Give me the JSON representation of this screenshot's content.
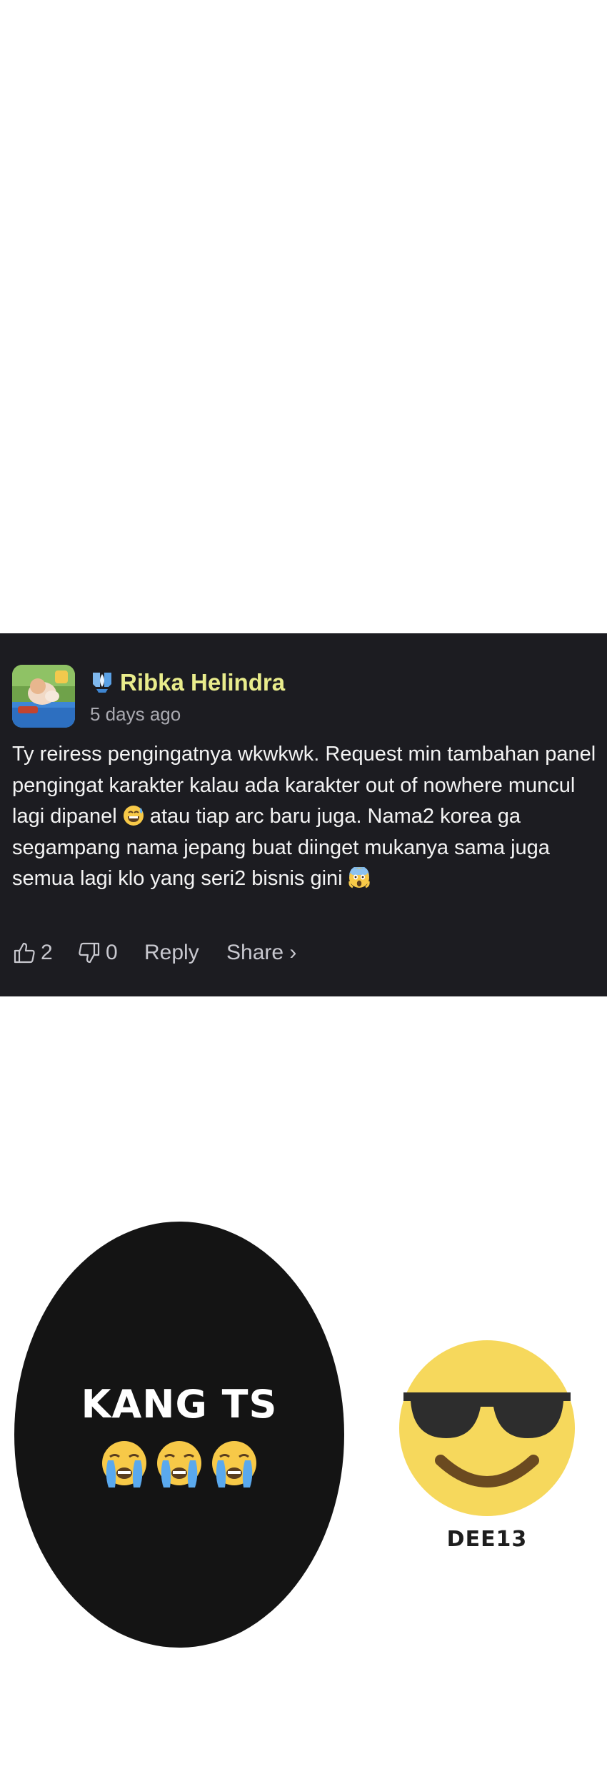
{
  "comment": {
    "author": "Ribka Helindra",
    "timestamp": "5 days ago",
    "body": {
      "part1": "Ty reiress pengingatnya wkwkwk. Request min tambahan panel pengingat karakter kalau ada karakter out of nowhere muncul lagi dipanel",
      "part2": "atau tiap arc baru juga. Nama2 korea ga segampang nama jepang buat diinget mukanya sama juga semua lagi klo yang seri2 bisnis gini"
    },
    "likes": "2",
    "dislikes": "0",
    "reply_label": "Reply",
    "share_label": "Share ›"
  },
  "oval": {
    "label": "KANG TS"
  },
  "cool": {
    "label": "DEE13"
  },
  "colors": {
    "card_bg": "#1c1c21",
    "author": "#e9ec8c",
    "muted": "#a9a9b0",
    "emoji_yellow": "#f6d85c"
  },
  "icons": [
    "avatar-image",
    "verified-badge-icon",
    "grin-sweat-emoji",
    "scream-emoji",
    "thumbs-up-icon",
    "thumbs-down-icon",
    "crying-emoji",
    "sunglasses-emoji"
  ]
}
